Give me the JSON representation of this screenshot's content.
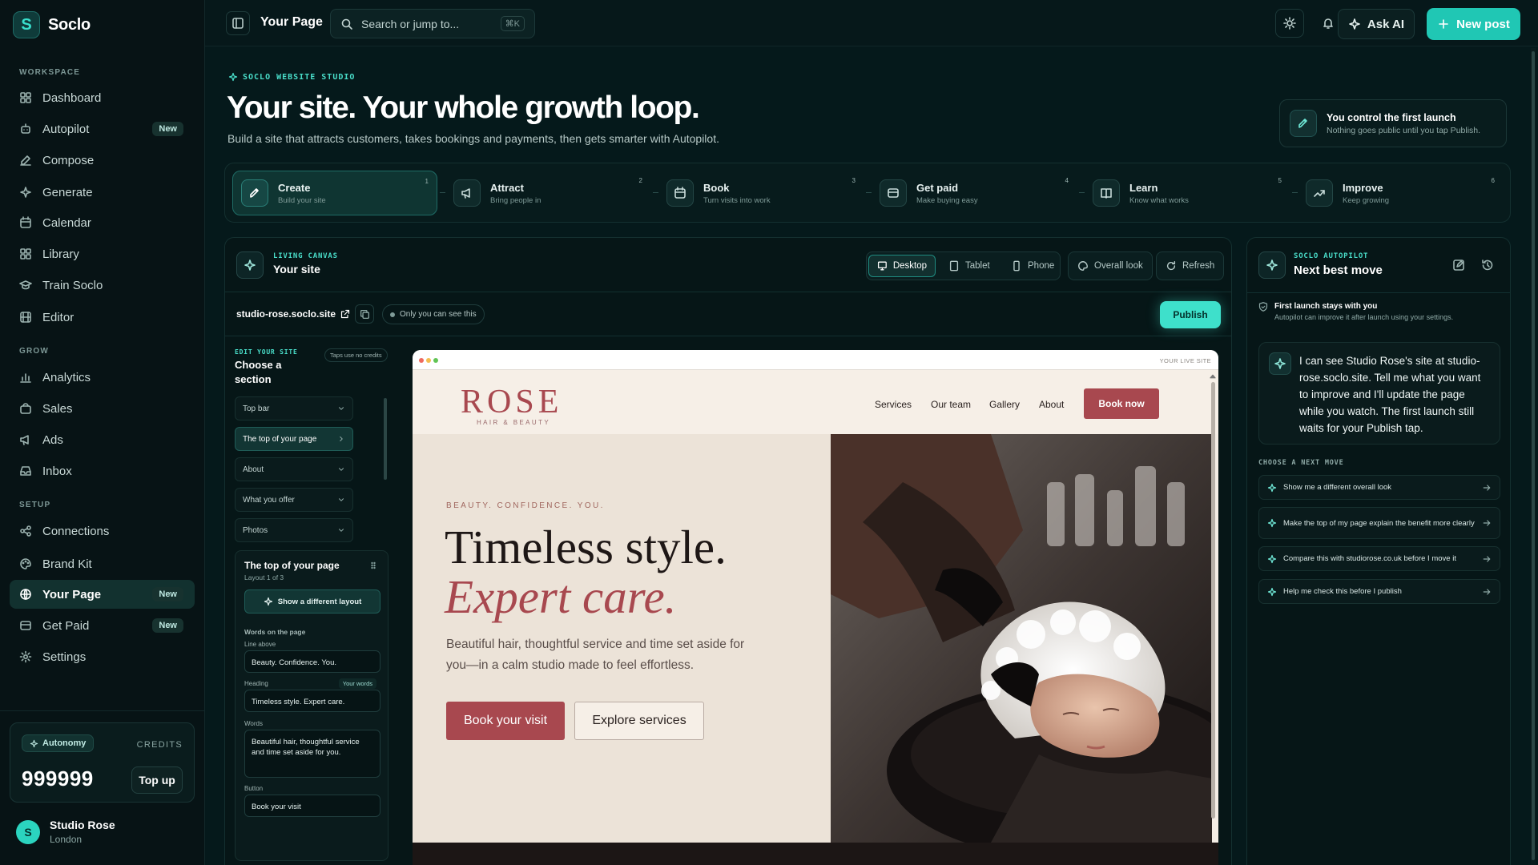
{
  "brand": {
    "name": "Soclo",
    "logo_letter": "S",
    "accent": "#20c7b4"
  },
  "sidebar": {
    "workspace_label": "WORKSPACE",
    "grow_label": "GROW",
    "setup_label": "SETUP",
    "items": [
      {
        "label": "Dashboard",
        "icon": "grid-icon"
      },
      {
        "label": "Autopilot",
        "icon": "robot-icon",
        "badge": "New"
      },
      {
        "label": "Compose",
        "icon": "pencil-icon"
      },
      {
        "label": "Generate",
        "icon": "sparkle-icon"
      },
      {
        "label": "Calendar",
        "icon": "calendar-icon"
      },
      {
        "label": "Library",
        "icon": "library-icon"
      },
      {
        "label": "Train Soclo",
        "icon": "graduation-cap-icon"
      },
      {
        "label": "Editor",
        "icon": "film-icon"
      },
      {
        "label": "Analytics",
        "icon": "bar-chart-icon"
      },
      {
        "label": "Sales",
        "icon": "shopping-bag-icon"
      },
      {
        "label": "Ads",
        "icon": "megaphone-icon"
      },
      {
        "label": "Inbox",
        "icon": "inbox-icon"
      },
      {
        "label": "Connections",
        "icon": "share-icon"
      },
      {
        "label": "Brand Kit",
        "icon": "palette-icon"
      },
      {
        "label": "Your Page",
        "icon": "globe-icon",
        "badge": "New",
        "active": true
      },
      {
        "label": "Get Paid",
        "icon": "credit-card-icon",
        "badge": "New"
      },
      {
        "label": "Settings",
        "icon": "gear-icon"
      }
    ],
    "credits": {
      "autonomy_label": "Autonomy",
      "credits_label": "CREDITS",
      "amount": "999999",
      "topup_label": "Top up"
    },
    "user": {
      "initial": "S",
      "name": "Studio Rose",
      "location": "London"
    }
  },
  "topbar": {
    "title": "Your Page",
    "search_placeholder": "Search or jump to...",
    "search_shortcut": "⌘K",
    "ask_ai_label": "Ask AI",
    "new_post_label": "New post"
  },
  "header": {
    "kicker": "SOCLO WEBSITE STUDIO",
    "title": "Your site. Your whole growth loop.",
    "subtitle": "Build a site that attracts customers, takes bookings and payments, then gets smarter with Autopilot.",
    "control_title": "You control the first launch",
    "control_sub": "Nothing goes public until you tap Publish."
  },
  "steps": [
    {
      "title": "Create",
      "sub": "Build your site",
      "num": "1",
      "icon": "brush-icon",
      "active": true
    },
    {
      "title": "Attract",
      "sub": "Bring people in",
      "num": "2",
      "icon": "megaphone-icon"
    },
    {
      "title": "Book",
      "sub": "Turn visits into work",
      "num": "3",
      "icon": "calendar-icon"
    },
    {
      "title": "Get paid",
      "sub": "Make buying easy",
      "num": "4",
      "icon": "credit-card-icon"
    },
    {
      "title": "Learn",
      "sub": "Know what works",
      "num": "5",
      "icon": "book-icon"
    },
    {
      "title": "Improve",
      "sub": "Keep growing",
      "num": "6",
      "icon": "trend-up-icon"
    }
  ],
  "canvas": {
    "kicker": "LIVING CANVAS",
    "title": "Your site",
    "devices": [
      "Desktop",
      "Tablet",
      "Phone"
    ],
    "overall_look_label": "Overall look",
    "refresh_label": "Refresh",
    "url": "studio-rose.soclo.site",
    "visibility": "Only you can see this",
    "publish_label": "Publish"
  },
  "editor": {
    "kicker": "EDIT YOUR SITE",
    "title": "Choose a section",
    "tip": "Taps use no credits",
    "sections": [
      {
        "label": "Top bar"
      },
      {
        "label": "The top of your page",
        "active": true
      },
      {
        "label": "About"
      },
      {
        "label": "What you offer"
      },
      {
        "label": "Photos"
      }
    ],
    "card": {
      "title": "The top of your page",
      "layout": "Layout 1 of 3",
      "layout_button": "Show a different layout",
      "words_label": "Words on the page",
      "line_above_label": "Line above",
      "line_above_value": "Beauty. Confidence. You.",
      "heading_label": "Heading",
      "your_words_tag": "Your words",
      "heading_value": "Timeless style. Expert care.",
      "words_field_label": "Words",
      "words_value": "Beautiful hair, thoughtful service and time set aside for you.",
      "button_label": "Button",
      "button_value": "Book your visit"
    }
  },
  "preview": {
    "live_label": "YOUR LIVE SITE",
    "brand": "ROSE",
    "brand_sub": "HAIR & BEAUTY",
    "nav": [
      "Services",
      "Our team",
      "Gallery",
      "About"
    ],
    "book_now": "Book now",
    "kicker": "BEAUTY. CONFIDENCE. YOU.",
    "headline_1": "Timeless style.",
    "headline_2": "Expert care.",
    "paragraph": "Beautiful hair, thoughtful service and time set aside for you—in a calm studio made to feel effortless.",
    "cta_primary": "Book your visit",
    "cta_secondary": "Explore services",
    "brand_color": "#a8484f"
  },
  "autopilot": {
    "kicker": "SOCLO AUTOPILOT",
    "title": "Next best move",
    "note_title": "First launch stays with you",
    "note_sub": "Autopilot can improve it after launch using your settings.",
    "message": "I can see Studio Rose's site at studio-rose.soclo.site. Tell me what you want to improve and I'll update the page while you watch. The first launch still waits for your Publish tap.",
    "choose_label": "CHOOSE A NEXT MOVE",
    "options": [
      "Show me a different overall look",
      "Make the top of my page explain the benefit more clearly",
      "Compare this with studiorose.co.uk before I move it",
      "Help me check this before I publish"
    ]
  }
}
